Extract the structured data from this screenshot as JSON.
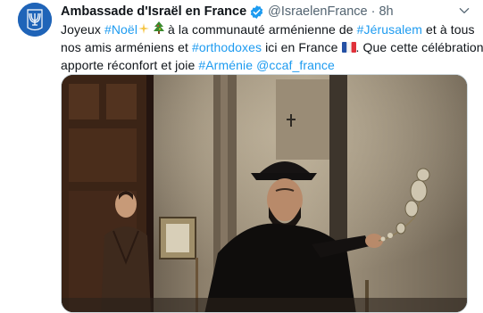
{
  "tweet": {
    "author_name": "Ambassade d'Israël en France",
    "handle": "@IsraelenFrance",
    "separator": "·",
    "time": "8h",
    "text": {
      "l1_a": "Joyeux ",
      "l1_tag_noel": "#Noël",
      "l1_b": " à la communauté arménienne de ",
      "l1_tag_jerusalem": "#Jérusalem",
      "l1_c": " et à tous",
      "l2_a": "nos amis arméniens et ",
      "l2_tag_orthodoxes": "#orthodoxes",
      "l2_b": " ici en France ",
      "l2_c": ". Que cette célébration",
      "l3_a": "apporte réconfort et joie ",
      "l3_tag_armenie": "#Arménie",
      "l3_space": " ",
      "l3_mention": "@ccaf_france"
    }
  },
  "colors": {
    "link": "#1d9bf0",
    "verified": "#1d9bf0",
    "avatar_bg": "#1f64b8",
    "secondary_text": "#536471"
  },
  "icons": {
    "avatar": "menorah-emblem-icon",
    "verified": "verified-badge-icon",
    "more": "chevron-down-icon",
    "sparkle": "sparkles-emoji",
    "tree": "christmas-tree-emoji",
    "flag": "french-flag-emoji"
  }
}
